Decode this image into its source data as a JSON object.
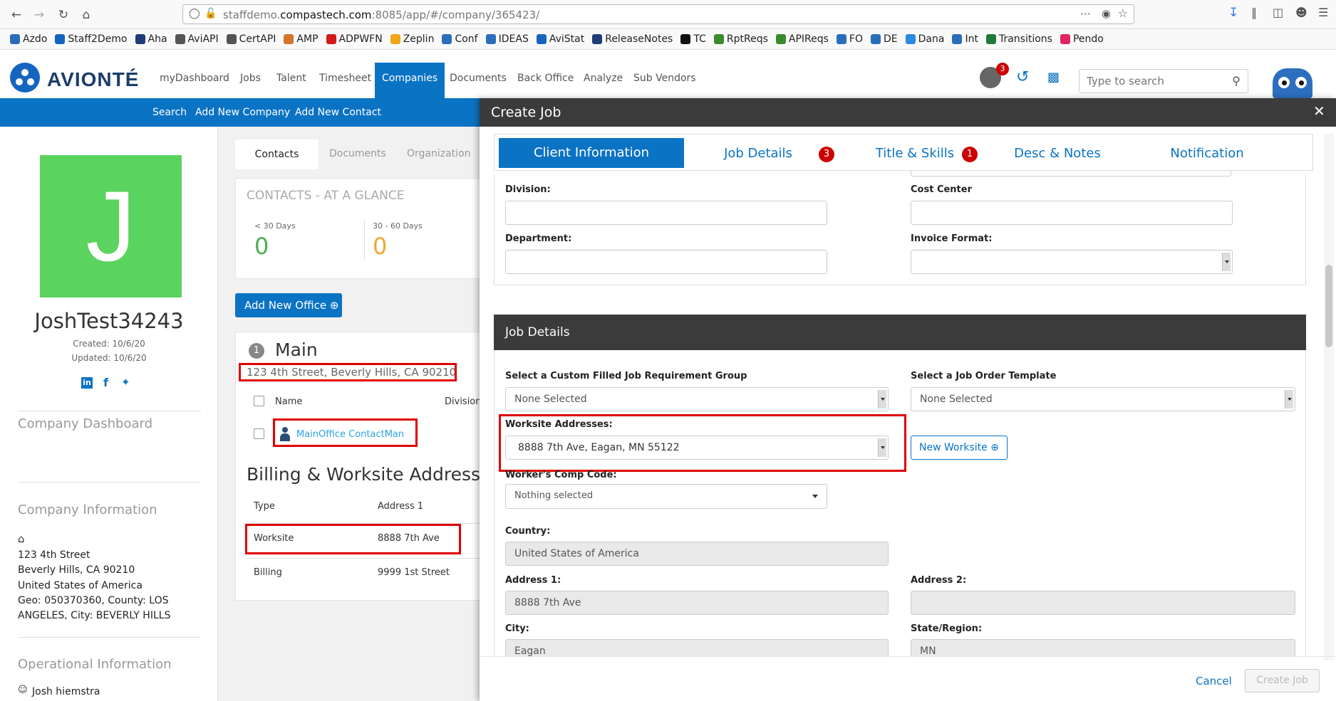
{
  "browser": {
    "url_host": "staffdemo.",
    "url_domain": "compastech.com",
    "url_rest": ":8085/app/#/company/365423/",
    "bookmarks": [
      {
        "label": "Azdo",
        "color": "#2a6ebb"
      },
      {
        "label": "Staff2Demo",
        "color": "#1565c0"
      },
      {
        "label": "Aha",
        "color": "#1e3c78"
      },
      {
        "label": "AviAPI",
        "color": "#555555"
      },
      {
        "label": "CertAPI",
        "color": "#555555"
      },
      {
        "label": "AMP",
        "color": "#d4742a"
      },
      {
        "label": "ADPWFN",
        "color": "#d21a1a"
      },
      {
        "label": "Zeplin",
        "color": "#f2a516"
      },
      {
        "label": "Conf",
        "color": "#2a6ebb"
      },
      {
        "label": "IDEAS",
        "color": "#2a6ebb"
      },
      {
        "label": "AviStat",
        "color": "#1565c0"
      },
      {
        "label": "ReleaseNotes",
        "color": "#1e3c78"
      },
      {
        "label": "TC",
        "color": "#111111"
      },
      {
        "label": "RptReqs",
        "color": "#3a8a2a"
      },
      {
        "label": "APIReqs",
        "color": "#3a8a2a"
      },
      {
        "label": "FO",
        "color": "#2a6ebb"
      },
      {
        "label": "DE",
        "color": "#2a6ebb"
      },
      {
        "label": "Dana",
        "color": "#2a8ae0"
      },
      {
        "label": "Int",
        "color": "#2a6ebb"
      },
      {
        "label": "Transitions",
        "color": "#1e7a3a"
      },
      {
        "label": "Pendo",
        "color": "#e0245e"
      }
    ]
  },
  "app": {
    "logo": "AVIONTÉ",
    "nav": [
      "myDashboard",
      "Jobs",
      "Talent",
      "Timesheet",
      "Companies",
      "Documents",
      "Back Office",
      "Analyze",
      "Sub Vendors"
    ],
    "active_nav": "Companies",
    "subnav": [
      "Search",
      "Add New Company",
      "Add New Contact"
    ],
    "notification_count": "3",
    "search_placeholder": "Type to search"
  },
  "company": {
    "initial": "J",
    "name": "JoshTest34243",
    "created": "Created: 10/6/20",
    "updated": "Updated: 10/6/20",
    "dashboard_heading": "Company Dashboard",
    "info_heading": "Company Information",
    "address_line1": "123 4th Street",
    "address_line2": "Beverly Hills, CA 90210",
    "address_line3": "United States of America",
    "address_line4": "Geo: 050370360, County: LOS",
    "address_line5": "ANGELES, City: BEVERLY HILLS",
    "operational_heading": "Operational Information",
    "owner": "Josh hiemstra"
  },
  "middle": {
    "tabs": [
      "Contacts",
      "Documents",
      "Organization"
    ],
    "glance_title": "CONTACTS - AT A GLANCE",
    "glance": [
      {
        "label": "< 30 Days",
        "value": "0",
        "color": "#4caf50"
      },
      {
        "label": "30 - 60 Days",
        "value": "0",
        "color": "#f0a830"
      }
    ],
    "add_office": "Add New Office",
    "office_number": "1",
    "office_name": "Main",
    "office_address": "123 4th Street, Beverly Hills, CA 90210",
    "col_name": "Name",
    "col_division": "Division",
    "contact": "MainOffice ContactMan",
    "billing_heading": "Billing & Worksite Addresses",
    "addr_col_type": "Type",
    "addr_col_address": "Address 1",
    "addresses": [
      {
        "type": "Worksite",
        "address": "8888 7th Ave"
      },
      {
        "type": "Billing",
        "address": "9999 1st Street"
      }
    ]
  },
  "modal": {
    "title": "Create Job",
    "tabs": [
      {
        "label": "Client Information",
        "badge": ""
      },
      {
        "label": "Job Details",
        "badge": "3"
      },
      {
        "label": "Title & Skills",
        "badge": "1"
      },
      {
        "label": "Desc & Notes",
        "badge": ""
      },
      {
        "label": "Notification",
        "badge": ""
      }
    ],
    "division_label": "Division:",
    "cost_center_label": "Cost Center",
    "department_label": "Department:",
    "invoice_format_label": "Invoice Format:",
    "job_details_heading": "Job Details",
    "custom_group_label": "Select a Custom Filled Job Requirement Group",
    "custom_group_value": "None Selected",
    "template_label": "Select a Job Order Template",
    "template_value": "None Selected",
    "worksite_label": "Worksite Addresses:",
    "worksite_value": "8888 7th Ave, Eagan, MN 55122",
    "new_worksite": "New Worksite",
    "comp_code_label": "Worker's Comp Code:",
    "comp_code_value": "Nothing selected",
    "country_label": "Country:",
    "country_value": "United States of America",
    "address1_label": "Address 1:",
    "address1_value": "8888 7th Ave",
    "address2_label": "Address 2:",
    "address2_value": "",
    "city_label": "City:",
    "city_value": "Eagan",
    "state_label": "State/Region:",
    "state_value": "MN",
    "cancel": "Cancel",
    "create": "Create Job"
  }
}
